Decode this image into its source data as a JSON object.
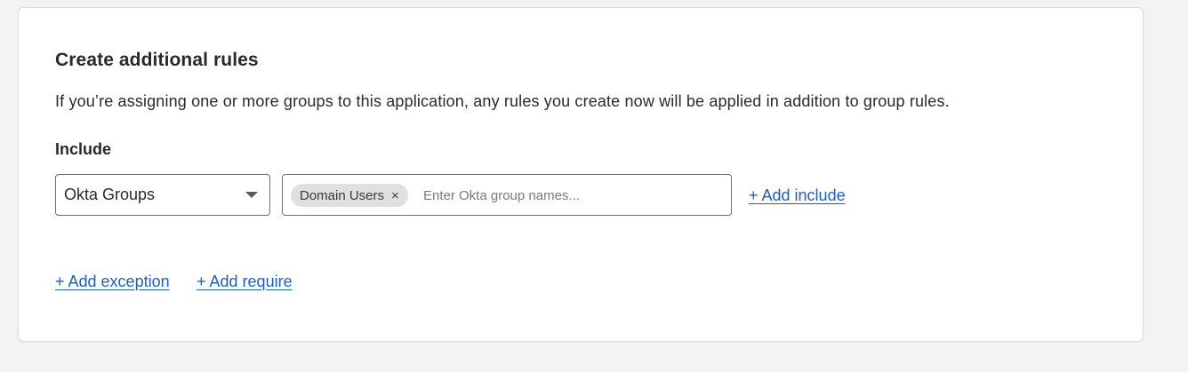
{
  "section": {
    "title": "Create additional rules",
    "description": "If you’re assigning one or more groups to this application, any rules you create now will be applied in addition to group rules.",
    "include_label": "Include"
  },
  "include": {
    "select_value": "Okta Groups",
    "chips": [
      {
        "label": "Domain Users",
        "remove_glyph": "×"
      }
    ],
    "placeholder": "Enter Okta group names...",
    "add_include_label": "+ Add include"
  },
  "actions": {
    "add_exception_label": "+ Add exception",
    "add_require_label": "+ Add require"
  },
  "colors": {
    "link": "#1f5fbf",
    "page_background": "#f3f3f3",
    "chip_background": "#e0e0e0"
  },
  "icons": {
    "select_caret": "chevron-down-icon",
    "chip_remove": "close-icon"
  }
}
